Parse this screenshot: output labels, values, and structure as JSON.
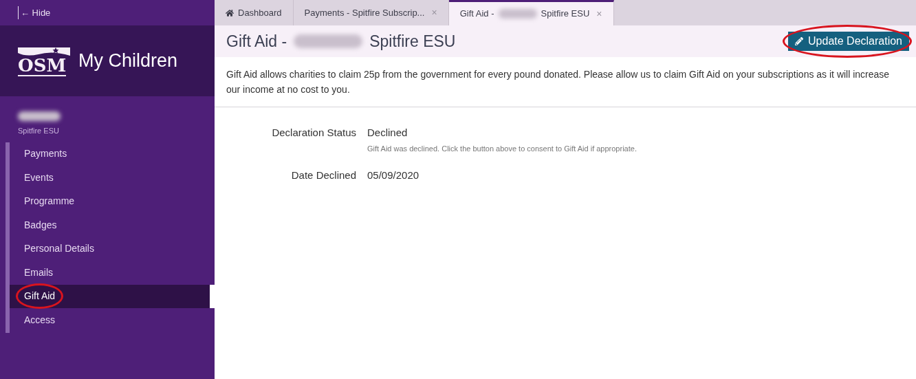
{
  "sidebar": {
    "hide_label": "← Hide",
    "logo_text": "OSM",
    "app_title": "My Children",
    "member": {
      "section": "Spitfire ESU"
    },
    "items": [
      {
        "label": "Payments",
        "selected": false,
        "circled": false
      },
      {
        "label": "Events",
        "selected": false,
        "circled": false
      },
      {
        "label": "Programme",
        "selected": false,
        "circled": false
      },
      {
        "label": "Badges",
        "selected": false,
        "circled": false
      },
      {
        "label": "Personal Details",
        "selected": false,
        "circled": false
      },
      {
        "label": "Emails",
        "selected": false,
        "circled": false
      },
      {
        "label": "Gift Aid",
        "selected": true,
        "circled": true
      },
      {
        "label": "Access",
        "selected": false,
        "circled": false
      }
    ]
  },
  "tabs": [
    {
      "kind": "home",
      "label": "Dashboard",
      "selected": false
    },
    {
      "kind": "closable",
      "label": "Payments - Spitfire Subscrip...",
      "selected": false,
      "close": "×"
    },
    {
      "kind": "closable",
      "label": "Gift Aid -",
      "label_after": "Spitfire ESU",
      "selected": true,
      "close": "×"
    }
  ],
  "page": {
    "title_before": "Gift Aid -",
    "title_after": "Spitfire ESU",
    "action": {
      "label": "Update Declaration",
      "circled": true
    },
    "intro": "Gift Aid allows charities to claim 25p from the government for every pound donated. Please allow us to claim Gift Aid on your subscriptions as it will increase our income at no cost to you.",
    "fields": [
      {
        "label": "Declaration Status",
        "value": "Declined",
        "hint": "Gift Aid was declined. Click the button above to consent to Gift Aid if appropriate."
      },
      {
        "label": "Date Declined",
        "value": "05/09/2020"
      }
    ]
  }
}
